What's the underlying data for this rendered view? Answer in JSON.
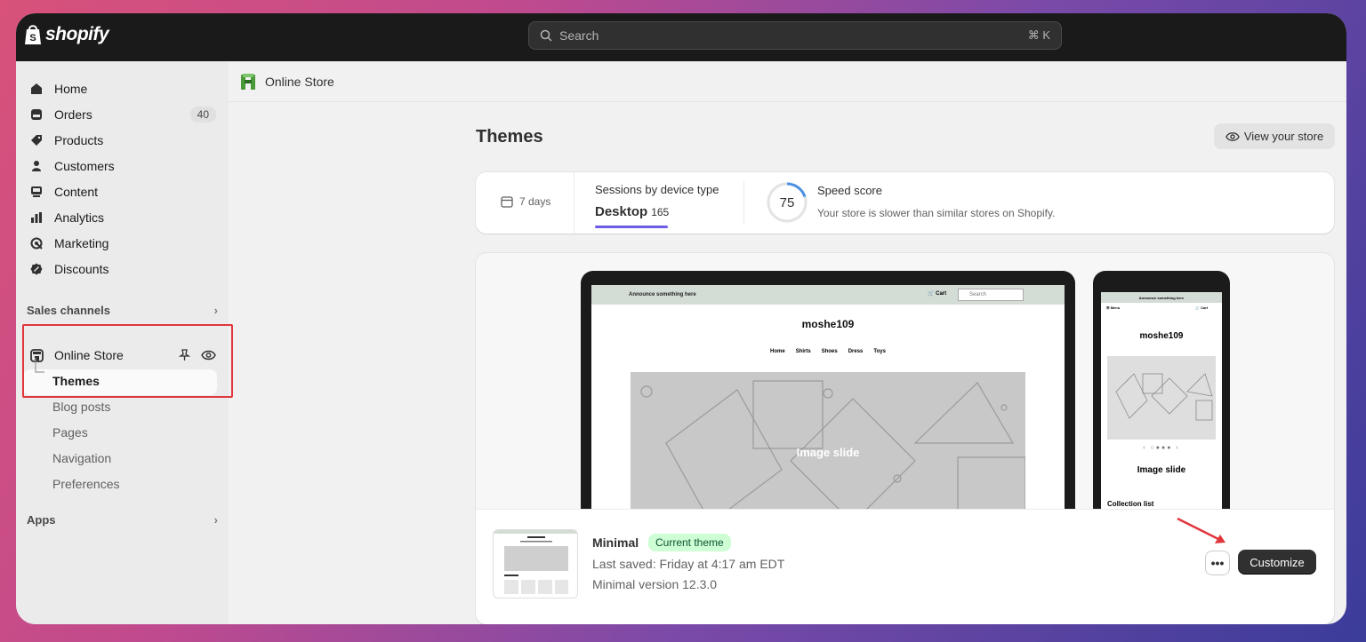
{
  "topbar": {
    "logo_text": "shopify",
    "search_placeholder": "Search",
    "search_shortcut": "⌘ K"
  },
  "sidebar": {
    "items": [
      {
        "label": "Home",
        "icon": "home-icon"
      },
      {
        "label": "Orders",
        "icon": "orders-icon",
        "badge": "40"
      },
      {
        "label": "Products",
        "icon": "tag-icon"
      },
      {
        "label": "Customers",
        "icon": "person-icon"
      },
      {
        "label": "Content",
        "icon": "content-icon"
      },
      {
        "label": "Analytics",
        "icon": "bar-chart-icon"
      },
      {
        "label": "Marketing",
        "icon": "target-icon"
      },
      {
        "label": "Discounts",
        "icon": "discount-icon"
      }
    ],
    "sales_channels_title": "Sales channels",
    "online_store_label": "Online Store",
    "subitems": [
      "Themes",
      "Blog posts",
      "Pages",
      "Navigation",
      "Preferences"
    ],
    "apps_title": "Apps"
  },
  "main": {
    "breadcrumb": "Online Store",
    "page_title": "Themes",
    "view_store_label": "View your store",
    "stats": {
      "days_label": "7 days",
      "sessions_label": "Sessions by device type",
      "device_label": "Desktop",
      "device_value": "165",
      "speed_score": "75",
      "speed_score_value": 75,
      "speed_label": "Speed score",
      "speed_desc": "Your store is slower than similar stores on Shopify."
    },
    "preview": {
      "announcement": "Announce something here",
      "cart": "Cart",
      "search": "Search",
      "store_name": "moshe109",
      "nav": [
        "Home",
        "Shirts",
        "Shoes",
        "Dress",
        "Toys"
      ],
      "slide_label": "Image slide",
      "mobile_menu": "Menu",
      "mobile_dots": "‹ ○●●● ›",
      "collection": "Collection list"
    },
    "theme": {
      "name": "Minimal",
      "badge": "Current theme",
      "last_saved": "Last saved: Friday at 4:17 am EDT",
      "version": "Minimal version 12.3.0",
      "more_label": "•••",
      "customize_label": "Customize"
    }
  },
  "colors": {
    "accent_purple": "#6b5ce7",
    "highlight_red": "#e0363c",
    "badge_green_bg": "#cdfed4"
  }
}
